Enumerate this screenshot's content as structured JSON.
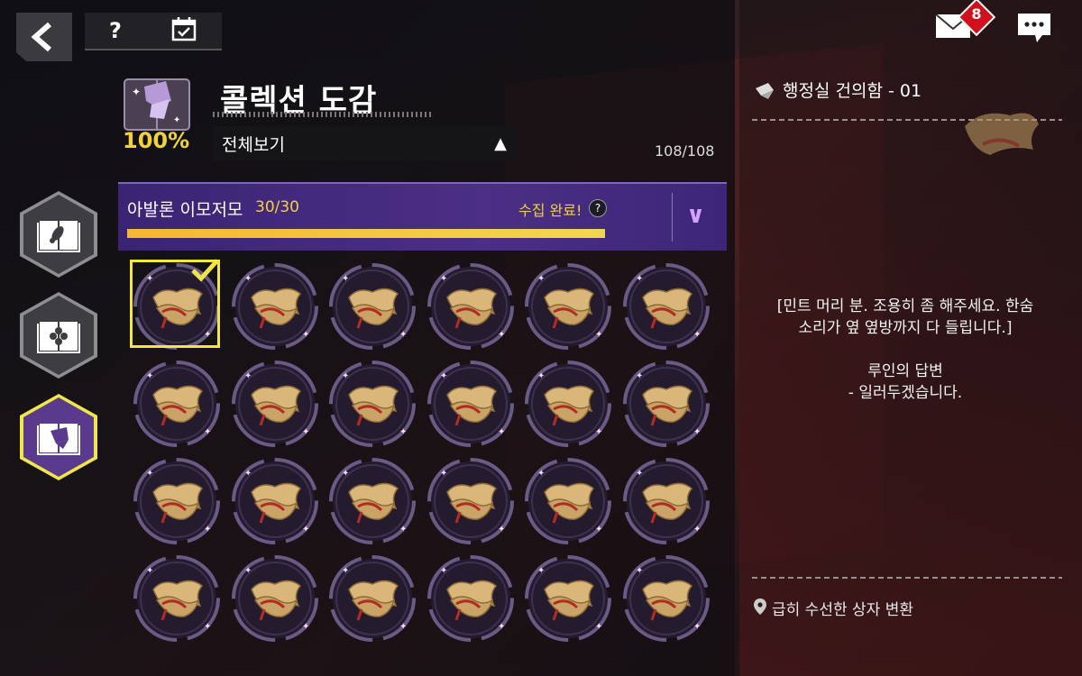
{
  "header": {
    "title": "콜렉션 도감",
    "completion_percent": "100%",
    "filter_label": "전체보기",
    "total_count": "108/108",
    "help_label": "?"
  },
  "notifications": {
    "mail_count": "8"
  },
  "category": {
    "name": "아발론 이모저모",
    "count": "30/30",
    "status": "수집 완료!",
    "help_label": "?",
    "progress": 1.0
  },
  "side_tabs": [
    {
      "name": "tab-collection-1",
      "active": false
    },
    {
      "name": "tab-collection-2",
      "active": false
    },
    {
      "name": "tab-collection-3",
      "active": true
    }
  ],
  "grid": {
    "rows": 4,
    "cols": 6,
    "selected_index": 0,
    "item_icon": "scroll-icon"
  },
  "detail": {
    "title": "행정실 건의함 - 01",
    "line1": "[민트 머리 분. 조용히 좀 해주세요. 한숨",
    "line2": "소리가 옆 옆방까지 다 들립니다.]",
    "line3": "루인의 답변",
    "line4": "- 일러두겠습니다.",
    "location": "급히 수선한 상자 변환"
  },
  "colors": {
    "accent_yellow": "#f0e54b",
    "category_purple": "#4b2f86",
    "progress_gold": "#f3d650",
    "badge_red": "#d0101b"
  }
}
